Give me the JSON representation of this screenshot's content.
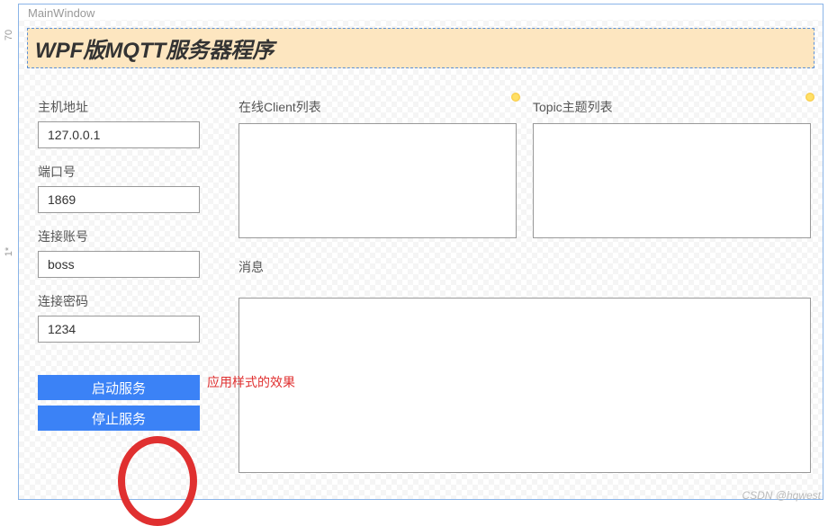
{
  "ruler": {
    "seg1": "70",
    "seg2": "1*"
  },
  "window": {
    "title": "MainWindow"
  },
  "header": {
    "title": "WPF版MQTT服务器程序"
  },
  "fields": {
    "host": {
      "label": "主机地址",
      "value": "127.0.0.1"
    },
    "port": {
      "label": "端口号",
      "value": "1869"
    },
    "account": {
      "label": "连接账号",
      "value": "boss"
    },
    "password": {
      "label": "连接密码",
      "value": "1234"
    }
  },
  "buttons": {
    "start": "启动服务",
    "stop": "停止服务"
  },
  "lists": {
    "clients": {
      "label": "在线Client列表"
    },
    "topics": {
      "label": "Topic主题列表"
    }
  },
  "messages": {
    "label": "消息"
  },
  "annotation": "应用样式的效果",
  "watermark": "CSDN @hqwest"
}
